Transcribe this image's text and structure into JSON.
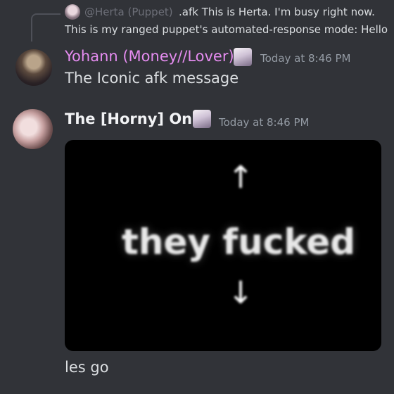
{
  "reply": {
    "author": "@Herta (Puppet)",
    "text_line1": ".afk This is Herta. I'm busy right now.",
    "text_line2": "This is my ranged puppet's automated-response mode: Hello"
  },
  "messages": [
    {
      "author": "Yohann (Money//Lover)",
      "author_color": "#e58cf0",
      "timestamp": "Today at 8:46 PM",
      "text": "The Iconic afk message"
    },
    {
      "author": "The [Horny] One",
      "author_color": "#f2f3f5",
      "timestamp": "Today at 8:46 PM",
      "image_text": "they fucked",
      "image_arrow_up": "↑",
      "image_arrow_down": "↓",
      "text": "les go"
    }
  ],
  "colors": {
    "background": "#313338",
    "muted": "#949ba4",
    "text": "#dbdee1"
  }
}
